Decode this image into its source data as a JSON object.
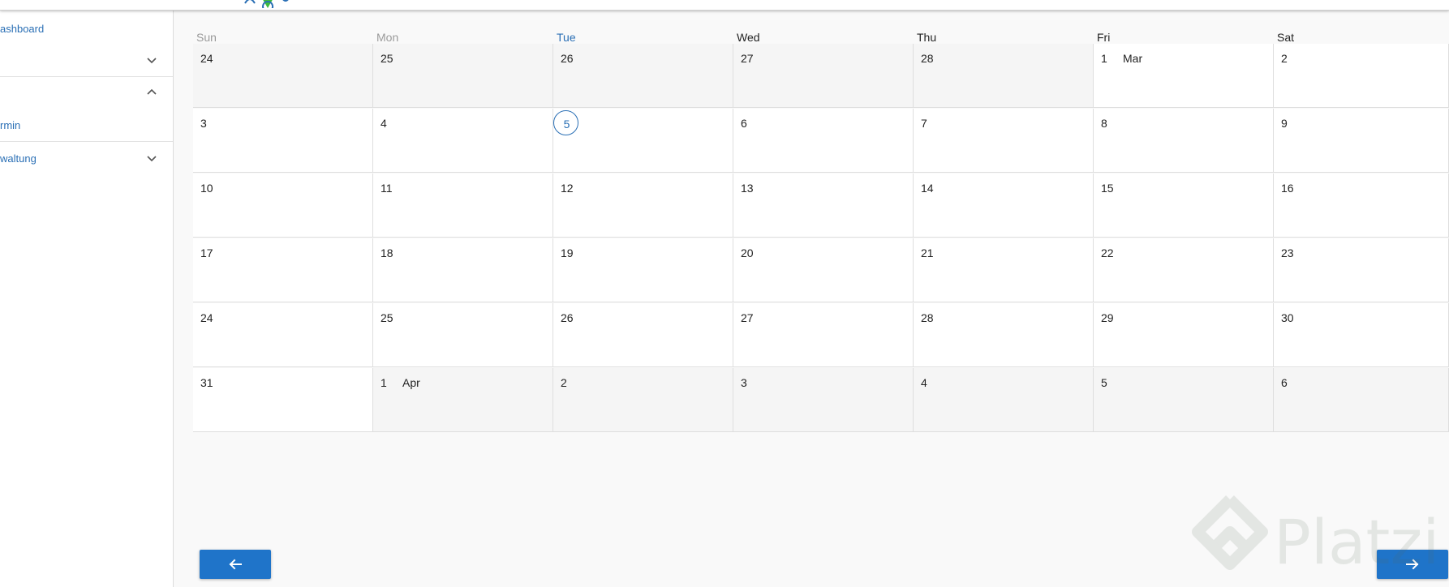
{
  "sidebar": {
    "items": [
      {
        "label": "ashboard",
        "expanded": null
      },
      {
        "label": "",
        "expanded": false
      },
      {
        "label": "",
        "expanded": true
      },
      {
        "label": "rmin",
        "expanded": null
      },
      {
        "label": "waltung",
        "expanded": false
      }
    ]
  },
  "calendar": {
    "weekdays": [
      "Sun",
      "Mon",
      "Tue",
      "Wed",
      "Thu",
      "Fri",
      "Sat"
    ],
    "today_weekday": "Tue",
    "muted_weekdays": [
      "Sun",
      "Mon"
    ],
    "weeks": [
      [
        {
          "day": "24",
          "out": true
        },
        {
          "day": "25",
          "out": true
        },
        {
          "day": "26",
          "out": true
        },
        {
          "day": "27",
          "out": true
        },
        {
          "day": "28",
          "out": true
        },
        {
          "day": "1",
          "month": "Mar"
        },
        {
          "day": "2"
        }
      ],
      [
        {
          "day": "3"
        },
        {
          "day": "4"
        },
        {
          "day": "5",
          "today": true
        },
        {
          "day": "6"
        },
        {
          "day": "7"
        },
        {
          "day": "8"
        },
        {
          "day": "9"
        }
      ],
      [
        {
          "day": "10"
        },
        {
          "day": "11"
        },
        {
          "day": "12"
        },
        {
          "day": "13"
        },
        {
          "day": "14"
        },
        {
          "day": "15"
        },
        {
          "day": "16"
        }
      ],
      [
        {
          "day": "17"
        },
        {
          "day": "18"
        },
        {
          "day": "19"
        },
        {
          "day": "20"
        },
        {
          "day": "21"
        },
        {
          "day": "22"
        },
        {
          "day": "23"
        }
      ],
      [
        {
          "day": "24"
        },
        {
          "day": "25"
        },
        {
          "day": "26"
        },
        {
          "day": "27"
        },
        {
          "day": "28"
        },
        {
          "day": "29"
        },
        {
          "day": "30"
        }
      ],
      [
        {
          "day": "31"
        },
        {
          "day": "1",
          "month": "Apr",
          "out": true
        },
        {
          "day": "2",
          "out": true
        },
        {
          "day": "3",
          "out": true
        },
        {
          "day": "4",
          "out": true
        },
        {
          "day": "5",
          "out": true
        },
        {
          "day": "6",
          "out": true
        }
      ]
    ]
  },
  "nav": {
    "prev_icon": "arrow-left-icon",
    "next_icon": "arrow-right-icon"
  },
  "watermark": {
    "text": "Platzi"
  },
  "colors": {
    "accent": "#2a6fb5",
    "button": "#1f74c9",
    "outside_month": "#f5f5f5"
  }
}
